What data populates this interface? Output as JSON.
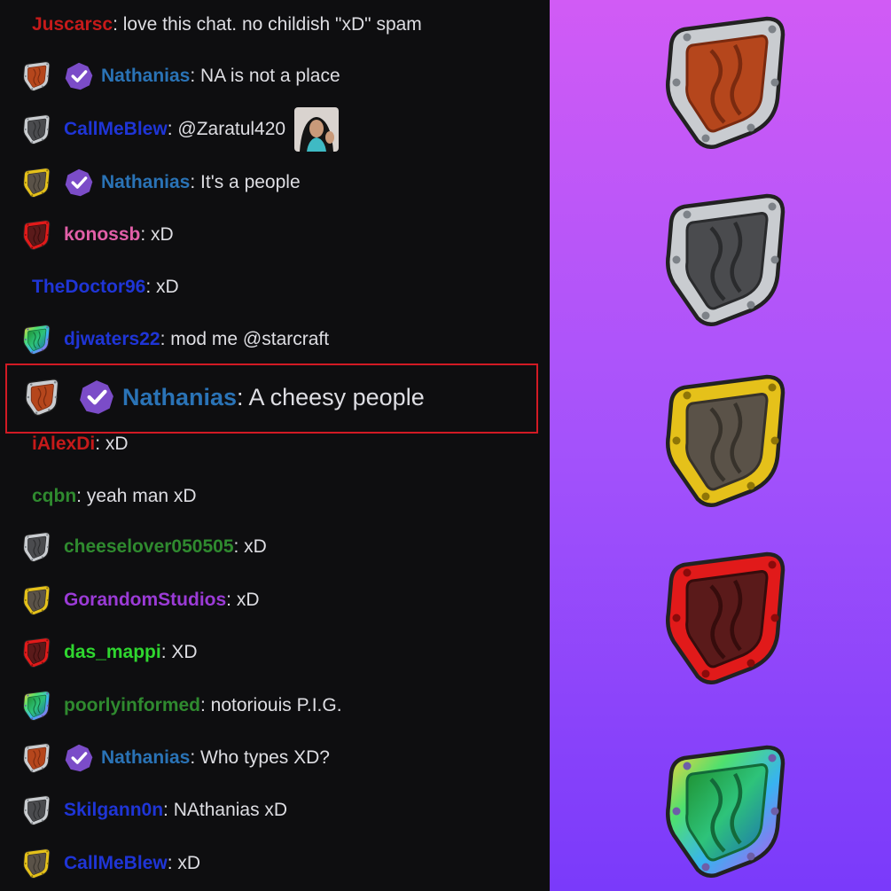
{
  "chat": {
    "messages": [
      {
        "shield": null,
        "verified": false,
        "user": "Juscarsc",
        "user_color": "#c61a1a",
        "text": ": love this chat. no childish \"xD\" spam",
        "emote": false
      },
      {
        "shield": "bronze",
        "verified": true,
        "user": "Nathanias",
        "user_color": "#2a73b6",
        "text": ": NA is not a place",
        "emote": false
      },
      {
        "shield": "silver",
        "verified": false,
        "user": "CallMeBlew",
        "user_color": "#1f35d6",
        "text": ": @Zaratul420",
        "emote": true
      },
      {
        "shield": "gold",
        "verified": true,
        "user": "Nathanias",
        "user_color": "#2a73b6",
        "text": ": It's a people",
        "emote": false
      },
      {
        "shield": "red",
        "verified": false,
        "user": "konossb",
        "user_color": "#e25fa8",
        "text": ": xD",
        "emote": false
      },
      {
        "shield": null,
        "verified": false,
        "user": "TheDoctor96",
        "user_color": "#1f35d6",
        "text": ": xD",
        "emote": false
      },
      {
        "shield": "rainbow",
        "verified": false,
        "user": "djwaters22",
        "user_color": "#1f35d6",
        "text": ": mod me @starcraft",
        "emote": false
      },
      {
        "shield": "bronze",
        "verified": true,
        "user": "Nathanias",
        "user_color": "#2a73b6",
        "text": ": A cheesy people",
        "emote": false,
        "highlight": true
      },
      {
        "shield": null,
        "verified": false,
        "user": "iAlexDi",
        "user_color": "#c61a1a",
        "text": ": xD",
        "emote": false
      },
      {
        "shield": null,
        "verified": false,
        "user": "cqbn",
        "user_color": "#2f8a2f",
        "text": ": yeah man xD",
        "emote": false
      },
      {
        "shield": "silver",
        "verified": false,
        "user": "cheeselover050505",
        "user_color": "#2f8a2f",
        "text": ": xD",
        "emote": false
      },
      {
        "shield": "gold",
        "verified": false,
        "user": "GorandomStudios",
        "user_color": "#9b3bd6",
        "text": ": xD",
        "emote": false
      },
      {
        "shield": "red",
        "verified": false,
        "user": "das_mappi",
        "user_color": "#2fd62f",
        "text": ": XD",
        "emote": false
      },
      {
        "shield": "rainbow",
        "verified": false,
        "user": "poorlyinformed",
        "user_color": "#2f8a2f",
        "text": ": notoriouis P.I.G.",
        "emote": false
      },
      {
        "shield": "bronze",
        "verified": true,
        "user": "Nathanias",
        "user_color": "#2a73b6",
        "text": ": Who types XD?",
        "emote": false
      },
      {
        "shield": "silver",
        "verified": false,
        "user": "Skilgann0n",
        "user_color": "#1f35d6",
        "text": ": NAthanias xD",
        "emote": false
      },
      {
        "shield": "gold",
        "verified": false,
        "user": "CallMeBlew",
        "user_color": "#1f35d6",
        "text": ": xD",
        "emote": false
      }
    ]
  },
  "panel": {
    "shields": [
      "bronze",
      "silver",
      "gold",
      "red",
      "rainbow"
    ]
  },
  "colors": {
    "chat_bg": "#0e0e10",
    "message_text": "#dedee3",
    "highlight_border": "#d11a24",
    "verified_badge": "#7b4cc8",
    "panel_top": "#d15bf5",
    "panel_bottom": "#7a3afa"
  }
}
